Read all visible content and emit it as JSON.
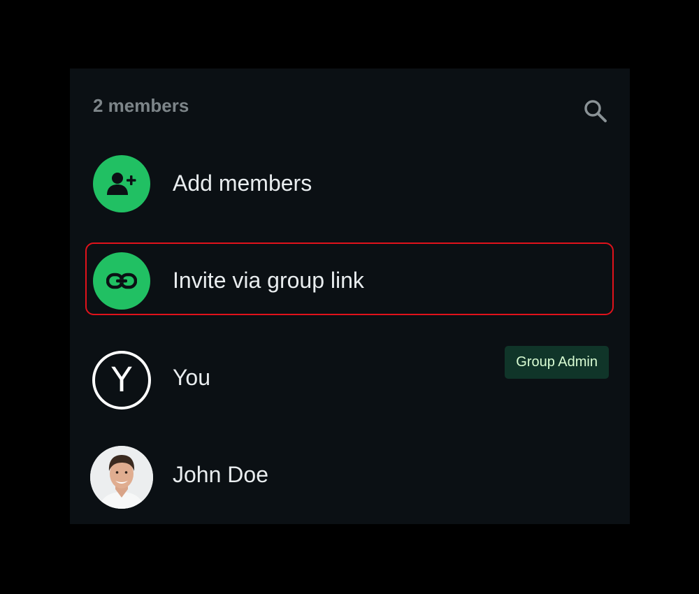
{
  "header": {
    "member_count": "2 members",
    "search_icon": "search-icon"
  },
  "actions": [
    {
      "label": "Add members",
      "icon": "add-person-icon",
      "icon_bg": "#21c063"
    },
    {
      "label": "Invite via group link",
      "icon": "link-icon",
      "icon_bg": "#21c063",
      "highlighted": true,
      "highlight_color": "#e0121b"
    }
  ],
  "members": [
    {
      "name": "You",
      "avatar_letter": "Y",
      "badge": "Group Admin"
    },
    {
      "name": "John Doe",
      "avatar": "profile-photo"
    }
  ],
  "colors": {
    "background": "#0b1014",
    "accent": "#21c063",
    "badge_bg": "#103529",
    "badge_text": "#d9fdd3"
  }
}
